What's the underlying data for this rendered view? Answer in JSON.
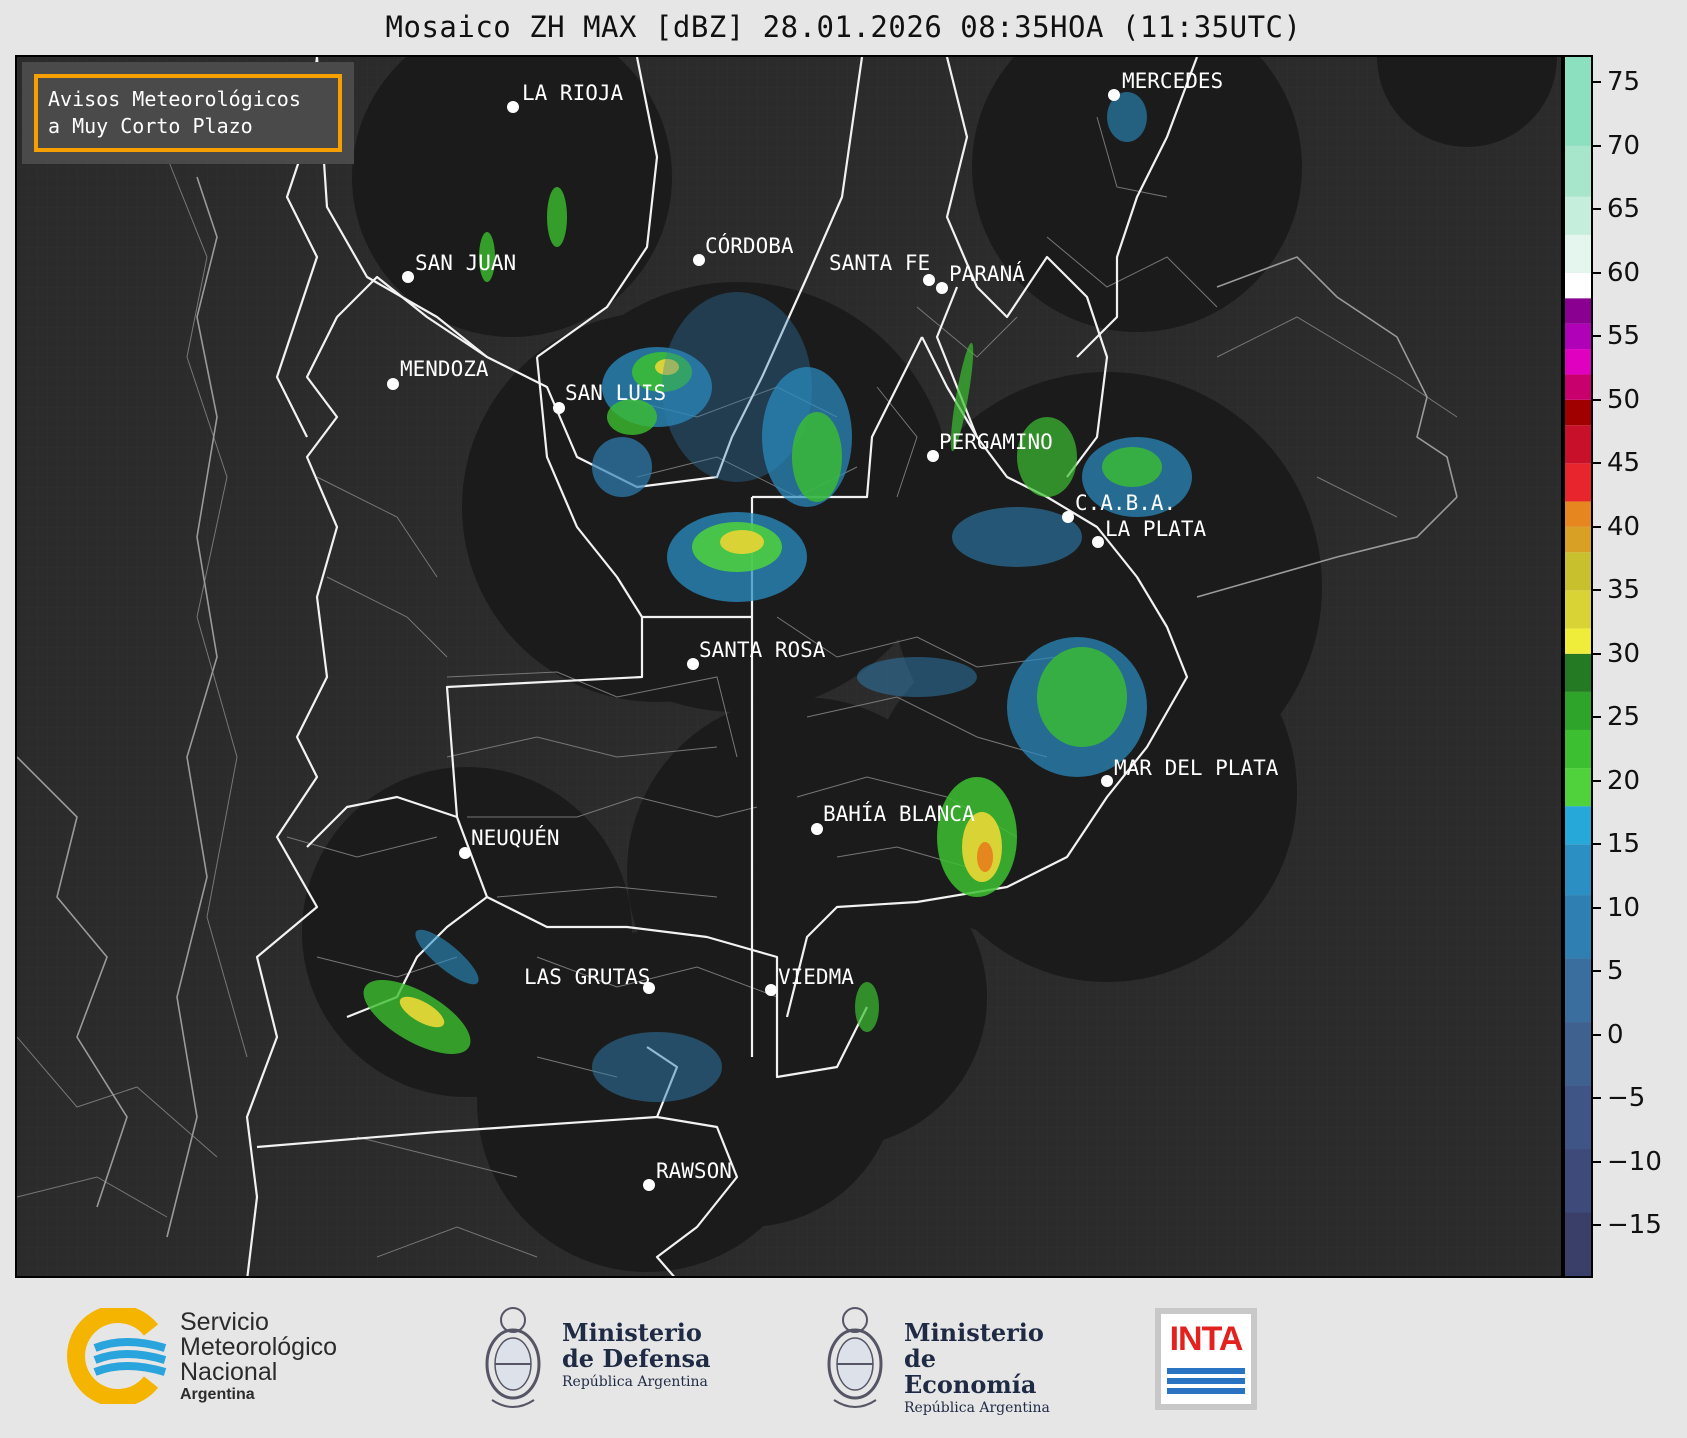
{
  "title": "Mosaico ZH MAX [dBZ] 28.01.2026 08:35HOA (11:35UTC)",
  "warning_box": {
    "line1": "Avisos Meteorológicos",
    "line2": "a Muy Corto Plazo",
    "border_color": "#f5a000"
  },
  "cities": [
    {
      "name": "LA RIOJA"
    },
    {
      "name": "MERCEDES"
    },
    {
      "name": "CÓRDOBA"
    },
    {
      "name": "SAN JUAN"
    },
    {
      "name": "SANTA FE"
    },
    {
      "name": "PARANÁ"
    },
    {
      "name": "MENDOZA"
    },
    {
      "name": "SAN LUIS"
    },
    {
      "name": "PERGAMINO"
    },
    {
      "name": "C.A.B.A."
    },
    {
      "name": "LA PLATA"
    },
    {
      "name": "SANTA ROSA"
    },
    {
      "name": "MAR DEL PLATA"
    },
    {
      "name": "BAHÍA BLANCA"
    },
    {
      "name": "NEUQUÉN"
    },
    {
      "name": "LAS GRUTAS"
    },
    {
      "name": "VIEDMA"
    },
    {
      "name": "RAWSON"
    }
  ],
  "colorbar": {
    "unit": "dBZ",
    "ticks": [
      "75",
      "70",
      "65",
      "60",
      "55",
      "50",
      "45",
      "40",
      "35",
      "30",
      "25",
      "20",
      "15",
      "10",
      "5",
      "0",
      "−5",
      "−10",
      "−15"
    ],
    "range": [
      -19,
      77
    ],
    "bands": [
      {
        "from": -19,
        "to": -14,
        "color": "#3a3f6a"
      },
      {
        "from": -14,
        "to": -9,
        "color": "#3d4a7a"
      },
      {
        "from": -9,
        "to": -4,
        "color": "#3f5585"
      },
      {
        "from": -4,
        "to": 1,
        "color": "#3f6190"
      },
      {
        "from": 1,
        "to": 6,
        "color": "#3a6e9e"
      },
      {
        "from": 6,
        "to": 11,
        "color": "#2f7fb3"
      },
      {
        "from": 11,
        "to": 15,
        "color": "#2b8fc4"
      },
      {
        "from": 15,
        "to": 18,
        "color": "#26a8d8"
      },
      {
        "from": 18,
        "to": 21,
        "color": "#4fd23c"
      },
      {
        "from": 21,
        "to": 24,
        "color": "#3cbf30"
      },
      {
        "from": 24,
        "to": 27,
        "color": "#2ea52a"
      },
      {
        "from": 27,
        "to": 30,
        "color": "#247a22"
      },
      {
        "from": 30,
        "to": 32,
        "color": "#f0ec3a"
      },
      {
        "from": 32,
        "to": 35,
        "color": "#d9d336"
      },
      {
        "from": 35,
        "to": 38,
        "color": "#c9c02e"
      },
      {
        "from": 38,
        "to": 40,
        "color": "#d8a024"
      },
      {
        "from": 40,
        "to": 42,
        "color": "#e6861f"
      },
      {
        "from": 42,
        "to": 45,
        "color": "#e8242c"
      },
      {
        "from": 45,
        "to": 48,
        "color": "#c8102a"
      },
      {
        "from": 48,
        "to": 50,
        "color": "#a00000"
      },
      {
        "from": 50,
        "to": 52,
        "color": "#c8006e"
      },
      {
        "from": 52,
        "to": 54,
        "color": "#e000c0"
      },
      {
        "from": 54,
        "to": 56,
        "color": "#b000b8"
      },
      {
        "from": 56,
        "to": 58,
        "color": "#8a0090"
      },
      {
        "from": 58,
        "to": 60,
        "color": "#ffffff"
      },
      {
        "from": 60,
        "to": 63,
        "color": "#e4f6ee"
      },
      {
        "from": 63,
        "to": 66,
        "color": "#c6eedc"
      },
      {
        "from": 66,
        "to": 70,
        "color": "#a8e6cc"
      },
      {
        "from": 70,
        "to": 77,
        "color": "#8cdfbf"
      }
    ]
  },
  "footer": {
    "smn": {
      "line1": "Servicio",
      "line2": "Meteorológico",
      "line3": "Nacional",
      "line4": "Argentina"
    },
    "defensa": {
      "line1": "Ministerio",
      "line2": "de Defensa",
      "line3": "República Argentina"
    },
    "economia": {
      "line1": "Ministerio",
      "line2": "de Economía",
      "line3": "República Argentina"
    },
    "inta": {
      "label": "INTA"
    }
  },
  "colors": {
    "map_background": "#2b2b2b",
    "radar_coverage": "#1a1a1a",
    "borders": "#ffffff"
  }
}
